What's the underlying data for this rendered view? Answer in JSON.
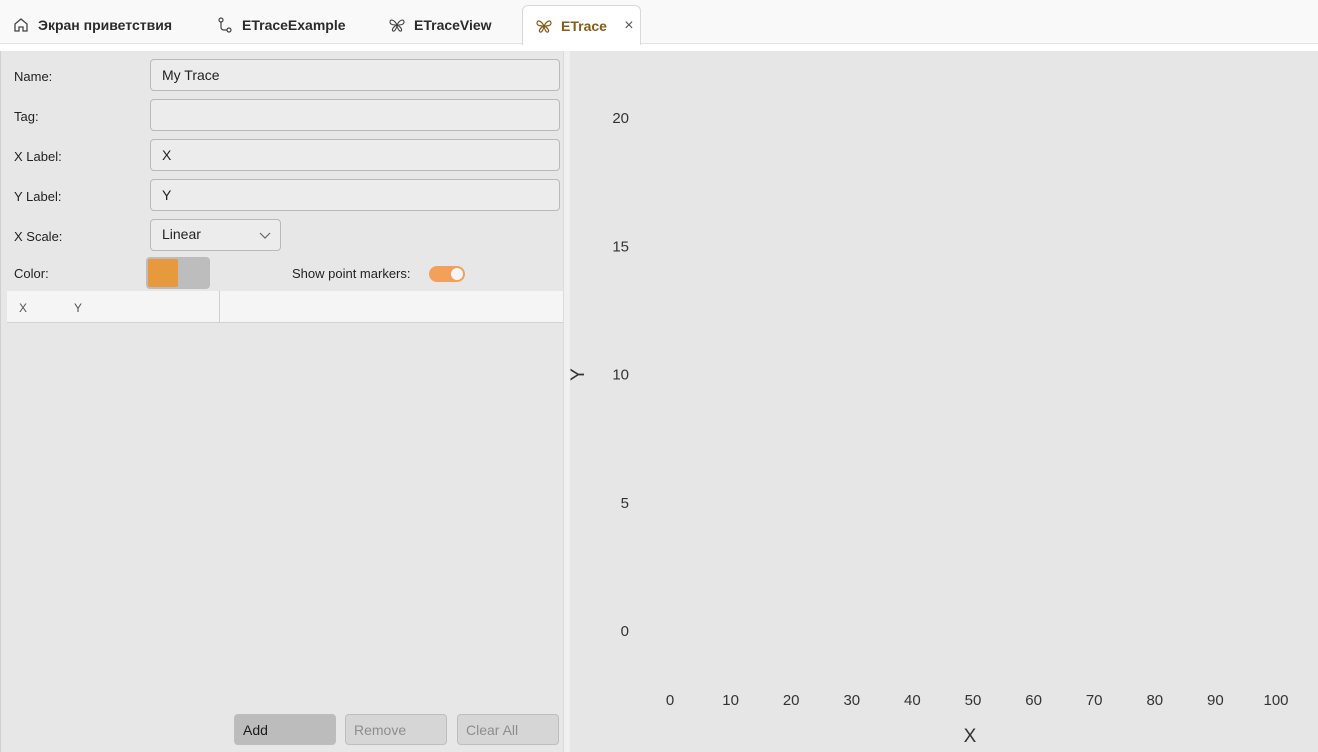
{
  "tabs": [
    {
      "label": "Экран приветствия",
      "icon": "home-icon"
    },
    {
      "label": "ETraceExample",
      "icon": "graph-nodes-icon"
    },
    {
      "label": "ETraceView",
      "icon": "butterfly-icon"
    },
    {
      "label": "ETrace",
      "icon": "butterfly-icon",
      "active": true,
      "close": "×"
    }
  ],
  "form": {
    "name_label": "Name:",
    "name_value": "My Trace",
    "tag_label": "Tag:",
    "tag_value": "",
    "xlabel_label": "X Label:",
    "xlabel_value": "X",
    "ylabel_label": "Y Label:",
    "ylabel_value": "Y",
    "xscale_label": "X Scale:",
    "xscale_value": "Linear",
    "color_label": "Color:",
    "color_value": "#e79a3d",
    "markers_label": "Show point markers:",
    "markers_on": true
  },
  "grid": {
    "columns": [
      "X",
      "Y"
    ],
    "rows": []
  },
  "buttons": {
    "add": "Add",
    "remove": "Remove",
    "clear_all": "Clear All"
  },
  "colors": {
    "accent": "#e79a3d",
    "toggle": "#f2a05a",
    "active_tab_text": "#8a5a17"
  },
  "chart_data": {
    "type": "line",
    "xlabel": "X",
    "ylabel": "Y",
    "xlim": [
      0,
      100
    ],
    "ylim": [
      0,
      20
    ],
    "xticks": [
      0,
      10,
      20,
      30,
      40,
      50,
      60,
      70,
      80,
      90,
      100
    ],
    "yticks": [
      0,
      5,
      10,
      15,
      20
    ],
    "series": [],
    "grid": false
  }
}
